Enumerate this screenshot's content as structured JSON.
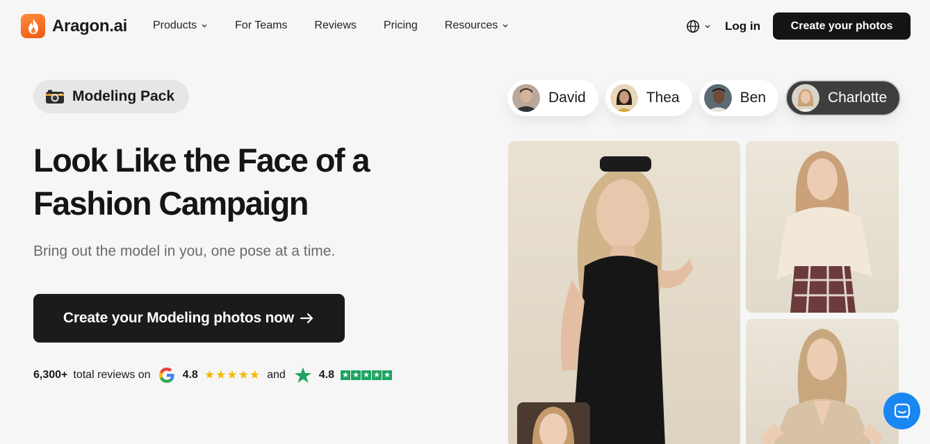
{
  "brand": {
    "name": "Aragon.ai"
  },
  "nav": {
    "items": [
      {
        "label": "Products",
        "dropdown": true
      },
      {
        "label": "For Teams",
        "dropdown": false
      },
      {
        "label": "Reviews",
        "dropdown": false
      },
      {
        "label": "Pricing",
        "dropdown": false
      },
      {
        "label": "Resources",
        "dropdown": true
      }
    ],
    "login": "Log in",
    "cta": "Create your photos"
  },
  "hero": {
    "pack_label": "Modeling Pack",
    "headline_line1": "Look Like the Face of a",
    "headline_line2": "Fashion Campaign",
    "subheadline": "Bring out the model in you, one pose at a time.",
    "cta": "Create your Modeling photos now",
    "reviews": {
      "count": "6,300+",
      "text": "total reviews on",
      "google_rating": "4.8",
      "and": "and",
      "trustpilot_rating": "4.8"
    }
  },
  "people": [
    {
      "name": "David",
      "active": false
    },
    {
      "name": "Thea",
      "active": false
    },
    {
      "name": "Ben",
      "active": false
    },
    {
      "name": "Charlotte",
      "active": true
    }
  ],
  "colors": {
    "brand_orange": "#f26b1d",
    "dark": "#141414",
    "background": "#f6f6f6",
    "star_yellow": "#f5b800",
    "trustpilot_green": "#1fa463",
    "chat_blue": "#1a86f2"
  },
  "icons": [
    "flame-logo-icon",
    "globe-icon",
    "chevron-down-icon",
    "camera-icon",
    "arrow-right-icon",
    "google-icon",
    "trustpilot-star-icon",
    "chat-icon"
  ]
}
